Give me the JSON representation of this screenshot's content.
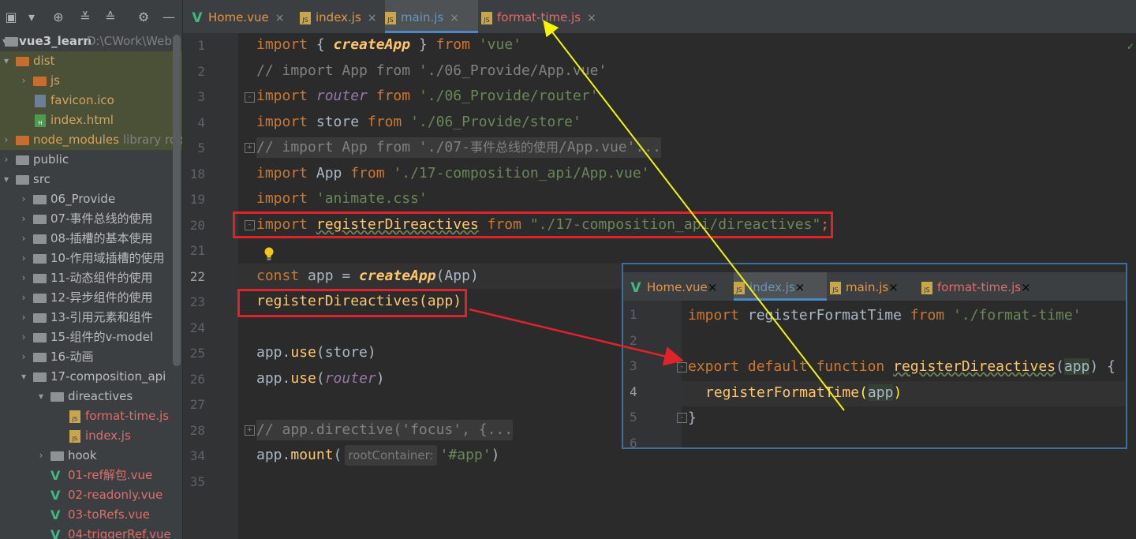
{
  "project": {
    "name": "vue3_learn",
    "path": "D:\\CWork\\WebS"
  },
  "tree": [
    {
      "label": "dist",
      "kind": "folder-orange",
      "indent": 0,
      "open": true
    },
    {
      "label": "js",
      "kind": "folder-orange",
      "indent": 1,
      "open": false
    },
    {
      "label": "favicon.ico",
      "kind": "file",
      "indent": 1
    },
    {
      "label": "index.html",
      "kind": "html",
      "indent": 1
    },
    {
      "label": "node_modules",
      "suffix": "library roo",
      "kind": "folder-orange",
      "indent": 0,
      "open": false
    },
    {
      "label": "public",
      "kind": "folder",
      "indent": 0,
      "open": false
    },
    {
      "label": "src",
      "kind": "folder",
      "indent": 0,
      "open": true
    },
    {
      "label": "06_Provide",
      "kind": "folder",
      "indent": 1,
      "open": false
    },
    {
      "label": "07-事件总线的使用",
      "kind": "folder",
      "indent": 1,
      "open": false
    },
    {
      "label": "08-插槽的基本使用",
      "kind": "folder",
      "indent": 1,
      "open": false
    },
    {
      "label": "10-作用域插槽的使用",
      "kind": "folder",
      "indent": 1,
      "open": false
    },
    {
      "label": "11-动态组件的使用",
      "kind": "folder",
      "indent": 1,
      "open": false
    },
    {
      "label": "12-异步组件的使用",
      "kind": "folder",
      "indent": 1,
      "open": false
    },
    {
      "label": "13-引用元素和组件",
      "kind": "folder",
      "indent": 1,
      "open": false
    },
    {
      "label": "15-组件的v-model",
      "kind": "folder",
      "indent": 1,
      "open": false
    },
    {
      "label": "16-动画",
      "kind": "folder",
      "indent": 1,
      "open": false
    },
    {
      "label": "17-composition_api",
      "kind": "folder",
      "indent": 1,
      "open": true
    },
    {
      "label": "direactives",
      "kind": "folder",
      "indent": 2,
      "open": true
    },
    {
      "label": "format-time.js",
      "kind": "js",
      "indent": 3
    },
    {
      "label": "index.js",
      "kind": "js",
      "indent": 3
    },
    {
      "label": "hook",
      "kind": "folder",
      "indent": 2,
      "open": false
    },
    {
      "label": "01-ref解包.vue",
      "kind": "vue",
      "indent": 2
    },
    {
      "label": "02-readonly.vue",
      "kind": "vue",
      "indent": 2
    },
    {
      "label": "03-toRefs.vue",
      "kind": "vue",
      "indent": 2
    },
    {
      "label": "04-triggerRef.vue",
      "kind": "vue",
      "indent": 2
    }
  ],
  "tabs": [
    {
      "label": "Home.vue",
      "icon": "vue"
    },
    {
      "label": "index.js",
      "icon": "js"
    },
    {
      "label": "main.js",
      "icon": "js",
      "active": true
    },
    {
      "label": "format-time.js",
      "icon": "js"
    }
  ],
  "editor": {
    "line_numbers": [
      "1",
      "2",
      "3",
      "4",
      "5",
      "18",
      "19",
      "20",
      "21",
      "22",
      "23",
      "24",
      "25",
      "26",
      "27",
      "28",
      "34",
      "35"
    ],
    "current_line": "22",
    "l1_a": "import",
    "l1_b": " { ",
    "l1_c": "createApp",
    "l1_d": " } ",
    "l1_e": "from",
    "l1_f": "'vue'",
    "l2": "// import App from './06_Provide/App.vue'",
    "l3_a": "import",
    "l3_b": "router",
    "l3_c": "from",
    "l3_d": "'./06_Provide/router'",
    "l4_a": "import",
    "l4_b": " store ",
    "l4_c": "from",
    "l4_d": "'./06_Provide/store'",
    "l5_a": "// import App from './07-",
    "l5_b": "事件总线的使用",
    "l5_c": "/App.vue'...",
    "l18_a": "import",
    "l18_b": " App ",
    "l18_c": "from",
    "l18_d": "'./17-composition_api/App.vue'",
    "l19_a": "import",
    "l19_b": "'animate.css'",
    "l20_a": "import",
    "l20_b": "registerDireactives",
    "l20_c": "from",
    "l20_d": "\"./17-composition_api/direactives\"",
    "l20_e": ";",
    "l22_a": "const",
    "l22_b": " app = ",
    "l22_c": "createApp",
    "l22_d": "(App)",
    "l23": "registerDireactives(app)",
    "l25_a": "app.",
    "l25_b": "use",
    "l25_c": "(store)",
    "l26_a": "app.",
    "l26_b": "use",
    "l26_c": "(",
    "l26_d": "router",
    "l26_e": ")",
    "l28": "// app.directive('focus', {...",
    "l34_a": "app.",
    "l34_b": "mount",
    "l34_c": "(",
    "l34_hint": "rootContainer:",
    "l34_d": "'#app'",
    "l34_e": ")"
  },
  "popup": {
    "tabs": [
      {
        "label": "Home.vue",
        "icon": "vue"
      },
      {
        "label": "index.js",
        "icon": "js",
        "active": true
      },
      {
        "label": "main.js",
        "icon": "js"
      },
      {
        "label": "format-time.js",
        "icon": "js"
      }
    ],
    "line_numbers": [
      "1",
      "2",
      "3",
      "4",
      "5",
      "6"
    ],
    "p1_a": "import",
    "p1_b": " registerFormatTime ",
    "p1_c": "from",
    "p1_d": "'./format-time'",
    "p3_a": "export",
    "p3_b": "default",
    "p3_c": "function",
    "p3_d": "registerDireactives",
    "p3_e": "(",
    "p3_f": "app",
    "p3_g": ") {",
    "p4_a": "registerFormatTime",
    "p4_b": "(",
    "p4_c": "app",
    "p4_d": ")",
    "p5": "}"
  },
  "colors": {
    "annotation_red": "#e0232b",
    "annotation_yellow": "#f5f500",
    "tab_underline": "#4a88c7"
  }
}
